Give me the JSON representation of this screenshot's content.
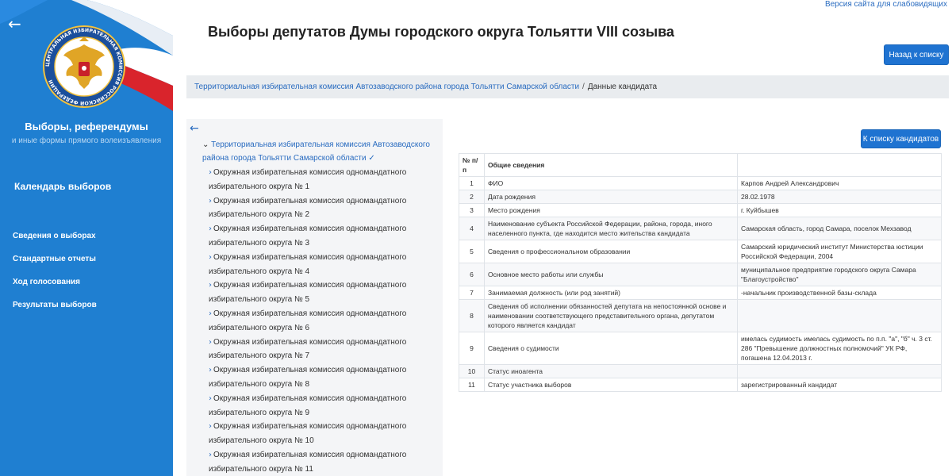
{
  "accessibility_link": "Версия сайта для слабовидящих",
  "sidebar": {
    "brand_title": "Выборы, референдумы",
    "brand_subtitle": "и иные формы прямого волеизъявления",
    "calendar": "Календарь выборов",
    "nav": [
      {
        "label": "Сведения о выборах"
      },
      {
        "label": "Стандартные отчеты"
      },
      {
        "label": "Ход голосования"
      },
      {
        "label": "Результаты выборов"
      }
    ],
    "emblem_text": "ЦЕНТРАЛЬНАЯ ИЗБИРАТЕЛЬНАЯ КОМИССИЯ РОССИЙСКОЙ ФЕДЕРАЦИИ"
  },
  "header": {
    "title": "Выборы депутатов Думы городского округа Тольятти VIII созыва",
    "back_button": "Назад к списку"
  },
  "breadcrumb": {
    "link": "Территориальная избирательная комиссия Автозаводского района города Тольятти Самарской области",
    "separator": "/",
    "current": "Данные кандидата"
  },
  "tree": {
    "root": "Территориальная избирательная комиссия Автозаводского района города Тольятти Самарской области",
    "items": [
      {
        "label": "Окружная избирательная комиссия одномандатного избирательного округа № 1"
      },
      {
        "label": "Окружная избирательная комиссия одномандатного избирательного округа № 2"
      },
      {
        "label": "Окружная избирательная комиссия одномандатного избирательного округа № 3"
      },
      {
        "label": "Окружная избирательная комиссия одномандатного избирательного округа № 4"
      },
      {
        "label": "Окружная избирательная комиссия одномандатного избирательного округа № 5"
      },
      {
        "label": "Окружная избирательная комиссия одномандатного избирательного округа № 6"
      },
      {
        "label": "Окружная избирательная комиссия одномандатного избирательного округа № 7"
      },
      {
        "label": "Окружная избирательная комиссия одномандатного избирательного округа № 8"
      },
      {
        "label": "Окружная избирательная комиссия одномандатного избирательного округа № 9"
      },
      {
        "label": "Окружная избирательная комиссия одномандатного избирательного округа № 10"
      },
      {
        "label": "Окружная избирательная комиссия одномандатного избирательного округа № 11"
      }
    ]
  },
  "candidate": {
    "button": "К списку кандидатов",
    "header": {
      "num": "№ п/п",
      "field": "Общие сведения",
      "value": ""
    },
    "rows": [
      {
        "num": "1",
        "field": "ФИО",
        "value": "Карпов Андрей Александрович"
      },
      {
        "num": "2",
        "field": "Дата рождения",
        "value": "28.02.1978"
      },
      {
        "num": "3",
        "field": "Место рождения",
        "value": "г. Куйбышев"
      },
      {
        "num": "4",
        "field": "Наименование субъекта Российской Федерации, района, города, иного населенного пункта, где находится место жительства кандидата",
        "value": "Самарская область, город Самара, поселок Мехзавод"
      },
      {
        "num": "5",
        "field": "Сведения о профессиональном образовании",
        "value": "Самарский юридический институт Министерства юстиции Российской Федерации, 2004"
      },
      {
        "num": "6",
        "field": "Основное место работы или службы",
        "value": "муниципальное предприятие городского округа Самара \"Благоустройство\""
      },
      {
        "num": "7",
        "field": "Занимаемая должность (или род занятий)",
        "value": "-начальник производственной базы-склада"
      },
      {
        "num": "8",
        "field": "Сведения об исполнении обязанностей депутата на непостоянной основе и наименовании соответствующего представительного органа, депутатом которого является кандидат",
        "value": ""
      },
      {
        "num": "9",
        "field": "Сведения о судимости",
        "value": "имелась судимость имелась судимость по п.п. \"а\", \"б\" ч. 3 ст. 286 \"Превышение должностных полномочий\" УК РФ, погашена 12.04.2013 г."
      },
      {
        "num": "10",
        "field": "Статус иноагента",
        "value": ""
      },
      {
        "num": "11",
        "field": "Статус участника выборов",
        "value": "зарегистрированный кандидат"
      }
    ]
  }
}
